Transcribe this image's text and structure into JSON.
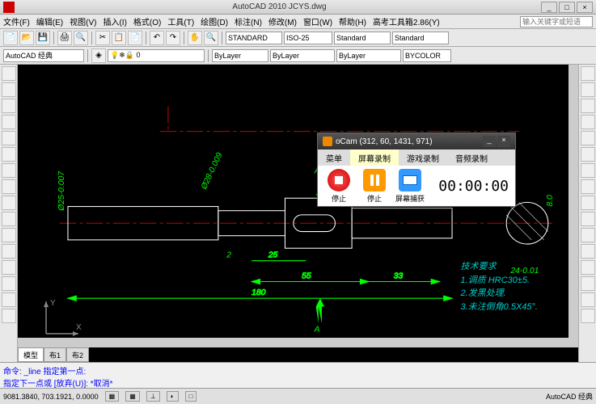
{
  "title": "AutoCAD 2010   JCYS.dwg",
  "search_placeholder": "输入关键字或短语",
  "menu": [
    "文件(F)",
    "编辑(E)",
    "视图(V)",
    "插入(I)",
    "格式(O)",
    "工具(T)",
    "绘图(D)",
    "标注(N)",
    "修改(M)",
    "窗口(W)",
    "帮助(H)",
    "高考工具箱2.86(Y)"
  ],
  "workspace": "AutoCAD 经典",
  "drop_standard1": "STANDARD",
  "drop_iso": "ISO-25",
  "drop_standard2": "Standard",
  "drop_standard3": "Standard",
  "drop_bylayer1": "ByLayer",
  "drop_bylayer2": "ByLayer",
  "drop_bylayer3": "ByLayer",
  "drop_bycolor": "BYCOLOR",
  "tabs": [
    "模型",
    "布1",
    "布2"
  ],
  "cmdline1": "命令: _line 指定第一点:",
  "cmdline2": "指定下一点或 [放弃(U)]: *取消*",
  "coords": "9081.3840, 703.1921, 0.0000",
  "status_right": "AutoCAD 经典",
  "tech": {
    "title": "技术要求",
    "l1": "1.调质 HRC30±5.",
    "l2": "2.发黑处理.",
    "l3": "3.未注倒角0.5X45°."
  },
  "dims": {
    "d180": "180",
    "d55": "55",
    "d33": "33",
    "d25": "25",
    "d2": "2",
    "d24": "24-0.01",
    "d8": "8.0",
    "d28": "Ø28-0.009",
    "d25v": "Ø25-0.007",
    "a1": "A",
    "a2": "A"
  },
  "ocam": {
    "title": "oCam (312, 60, 1431, 971)",
    "tabs": [
      "菜单",
      "屏幕录制",
      "游戏录制",
      "音频录制"
    ],
    "stop1": "停止",
    "stop2": "停止",
    "capture": "屏幕捕获",
    "timer": "00:00:00"
  }
}
